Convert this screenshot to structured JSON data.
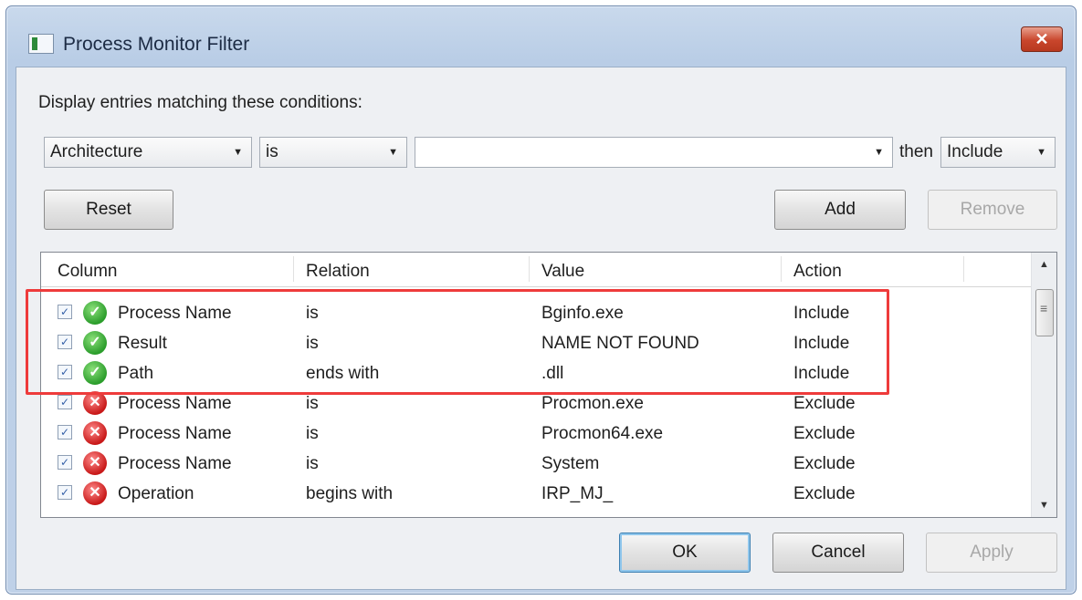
{
  "window": {
    "title": "Process Monitor Filter",
    "close_glyph": "✕"
  },
  "prompt": "Display entries matching these conditions:",
  "condition": {
    "column": "Architecture",
    "relation": "is",
    "value": "",
    "then_label": "then",
    "action": "Include"
  },
  "buttons": {
    "reset": "Reset",
    "add": "Add",
    "remove": "Remove",
    "ok": "OK",
    "cancel": "Cancel",
    "apply": "Apply"
  },
  "list": {
    "headers": [
      "Column",
      "Relation",
      "Value",
      "Action"
    ],
    "rows": [
      {
        "column": "Process Name",
        "relation": "is",
        "value": "Bginfo.exe",
        "action": "Include",
        "status": "include"
      },
      {
        "column": "Result",
        "relation": "is",
        "value": "NAME NOT FOUND",
        "action": "Include",
        "status": "include"
      },
      {
        "column": "Path",
        "relation": "ends with",
        "value": ".dll",
        "action": "Include",
        "status": "include"
      },
      {
        "column": "Process Name",
        "relation": "is",
        "value": "Procmon.exe",
        "action": "Exclude",
        "status": "exclude"
      },
      {
        "column": "Process Name",
        "relation": "is",
        "value": "Procmon64.exe",
        "action": "Exclude",
        "status": "exclude"
      },
      {
        "column": "Process Name",
        "relation": "is",
        "value": "System",
        "action": "Exclude",
        "status": "exclude"
      },
      {
        "column": "Operation",
        "relation": "begins with",
        "value": "IRP_MJ_",
        "action": "Exclude",
        "status": "exclude"
      }
    ]
  },
  "colors": {
    "highlight": "#ee3b3b",
    "include": "#2b9d2b",
    "exclude": "#c81818"
  },
  "icons": {
    "include": "check-circle-icon",
    "exclude": "x-circle-icon"
  }
}
